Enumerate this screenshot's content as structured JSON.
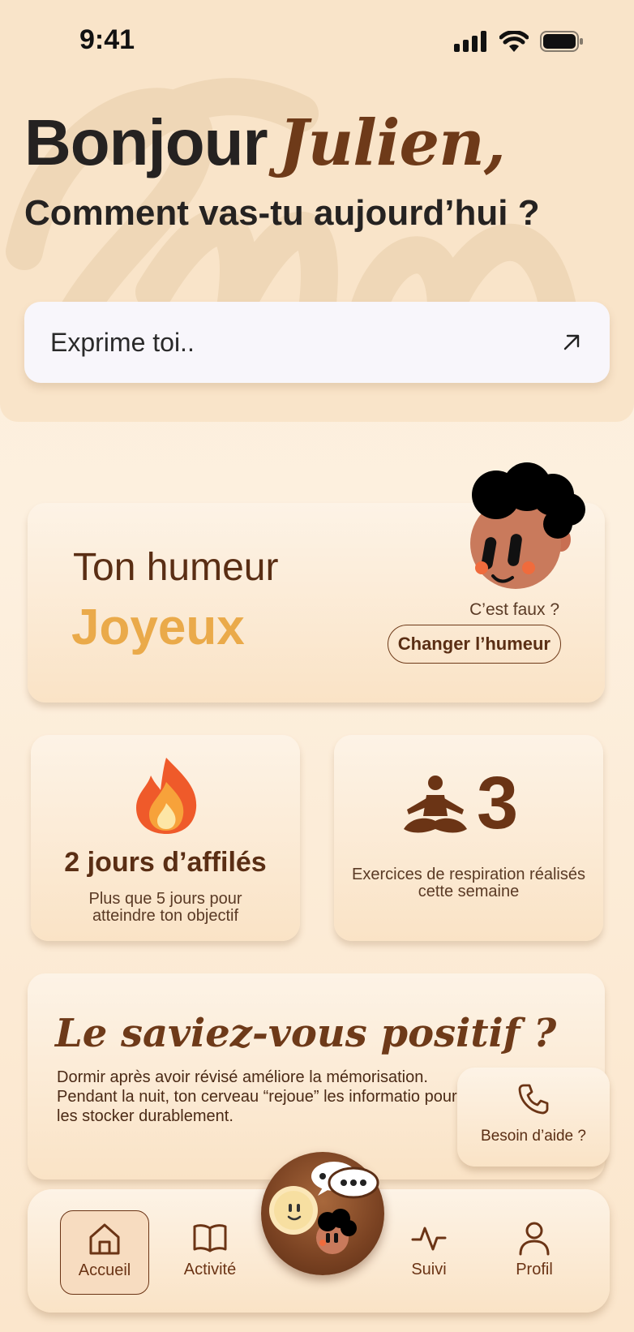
{
  "status_bar": {
    "time": "9:41"
  },
  "greeting": {
    "hello": "Bonjour",
    "name": "Julien,",
    "question": "Comment vas-tu aujourd’hui ?"
  },
  "input": {
    "placeholder": "Exprime toi.."
  },
  "mood": {
    "title": "Ton humeur",
    "value": "Joyeux",
    "question": "C’est faux ?",
    "button_label": "Changer l’humeur"
  },
  "streak": {
    "title": "2 jours d’affilés",
    "subtitle": "Plus que 5 jours pour atteindre ton objectif"
  },
  "breathing": {
    "count": "3",
    "subtitle": "Exercices de respiration réalisés cette semaine"
  },
  "fact": {
    "title": "Le saviez-vous positif ?",
    "body": "Dormir après avoir révisé améliore la mémorisation. Pendant la nuit, ton cerveau “rejoue” les informatio pour les stocker durablement."
  },
  "help": {
    "label": "Besoin d’aide ?"
  },
  "nav": {
    "items": [
      {
        "label": "Accueil",
        "icon": "home-icon",
        "active": true
      },
      {
        "label": "Activité",
        "icon": "book-icon",
        "active": false
      },
      {
        "label": "Suivi",
        "icon": "activity-icon",
        "active": false
      },
      {
        "label": "Profil",
        "icon": "user-icon",
        "active": false
      }
    ]
  },
  "colors": {
    "brown": "#6e3a19",
    "mood_accent": "#eaaa4a",
    "background": "#fbecd7"
  }
}
